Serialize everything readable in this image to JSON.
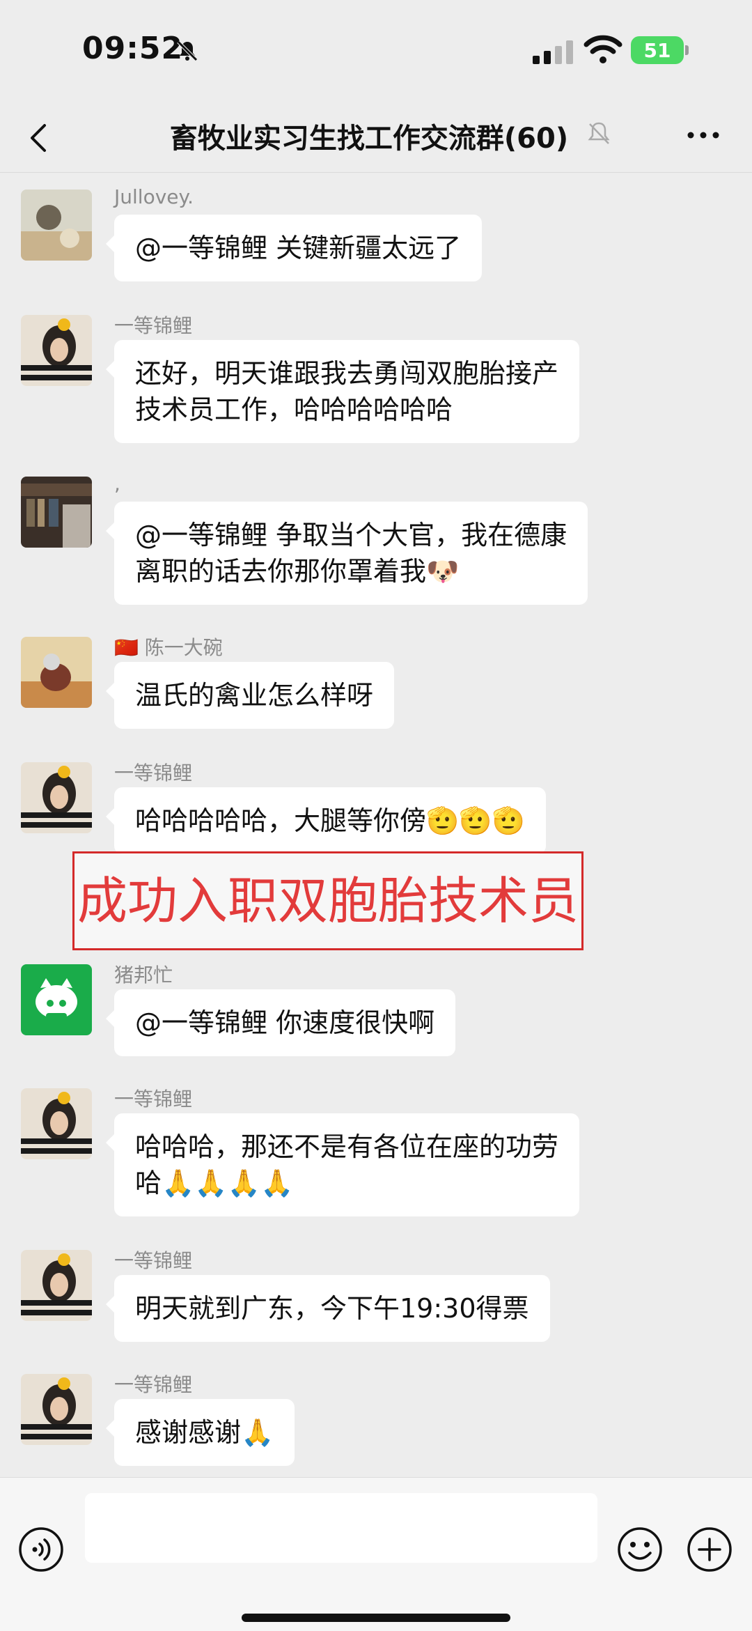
{
  "status_bar": {
    "time": "09:52",
    "battery": "51",
    "icons": [
      "mute-bell-icon",
      "cellular-signal-icon",
      "wifi-icon",
      "battery-charging-icon"
    ]
  },
  "nav": {
    "title": "畜牧业实习生找工作交流群(60)",
    "icons": [
      "back-chevron-icon",
      "muted-bell-icon",
      "more-dots-icon"
    ]
  },
  "messages": [
    {
      "sender": "Jullovey.",
      "text": "@一等锦鲤 关键新疆太远了"
    },
    {
      "sender": "一等锦鲤",
      "text": "还好，明天谁跟我去勇闯双胞胎接产\n技术员工作，哈哈哈哈哈哈"
    },
    {
      "sender": ",",
      "text": "@一等锦鲤 争取当个大官，我在德康\n离职的话去你那你罩着我🐶"
    },
    {
      "sender": "🇨🇳 陈一大碗",
      "text": "温氏的禽业怎么样呀"
    },
    {
      "sender": "一等锦鲤",
      "text": "哈哈哈哈哈，大腿等你傍🫡🫡🫡"
    },
    {
      "sender": "猪邦忙",
      "text": "@一等锦鲤 你速度很快啊"
    },
    {
      "sender": "一等锦鲤",
      "text": "哈哈哈，那还不是有各位在座的功劳\n哈🙏🙏🙏🙏"
    },
    {
      "sender": "一等锦鲤",
      "text": "明天就到广东，今下午19:30得票"
    },
    {
      "sender": "一等锦鲤",
      "text": "感谢感谢🙏"
    }
  ],
  "overlay_caption": "成功入职双胞胎技术员",
  "input_bar": {
    "placeholder": "",
    "icons": [
      "voice-icon",
      "emoji-face-icon",
      "plus-icon"
    ]
  },
  "colors": {
    "background": "#ededed",
    "bubble": "#ffffff",
    "caption_red": "#e23b3b",
    "battery_green": "#4cd964",
    "sender_gray": "#8b8b8b"
  }
}
